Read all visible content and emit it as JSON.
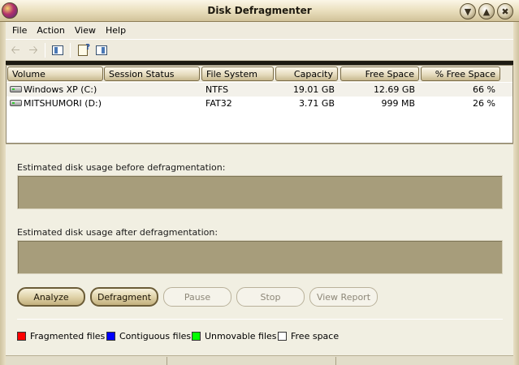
{
  "window": {
    "title": "Disk Defragmenter"
  },
  "menu": [
    "File",
    "Action",
    "View",
    "Help"
  ],
  "toolbar": {
    "items": [
      "back-icon",
      "forward-icon",
      "show-hide-console-tree-icon",
      "properties-help-icon",
      "show-hide-action-pane-icon"
    ]
  },
  "volumes": {
    "headers": {
      "volume": "Volume",
      "status": "Session Status",
      "filesystem": "File System",
      "capacity": "Capacity",
      "free": "Free Space",
      "pctfree": "% Free Space"
    },
    "rows": [
      {
        "volume": "Windows XP (C:)",
        "status": "",
        "filesystem": "NTFS",
        "capacity": "19.01 GB",
        "free": "12.69 GB",
        "pctfree": "66 %"
      },
      {
        "volume": "MITSHUMORI (D:)",
        "status": "",
        "filesystem": "FAT32",
        "capacity": "3.71 GB",
        "free": "999 MB",
        "pctfree": "26 %"
      }
    ]
  },
  "analysis": {
    "before_label": "Estimated disk usage before defragmentation:",
    "after_label": "Estimated disk usage after defragmentation:"
  },
  "buttons": {
    "analyze": "Analyze",
    "defragment": "Defragment",
    "pause": "Pause",
    "stop": "Stop",
    "view_report": "View Report"
  },
  "legend": {
    "fragmented": {
      "label": "Fragmented files",
      "color": "#ff0000"
    },
    "contiguous": {
      "label": "Contiguous files",
      "color": "#0000ff"
    },
    "unmovable": {
      "label": "Unmovable files",
      "color": "#00ff00"
    },
    "free": {
      "label": "Free space",
      "color": "#ffffff"
    }
  },
  "colors": {
    "usage_bar_fill": "#a79d7b",
    "panel_background": "#f1efe2"
  }
}
